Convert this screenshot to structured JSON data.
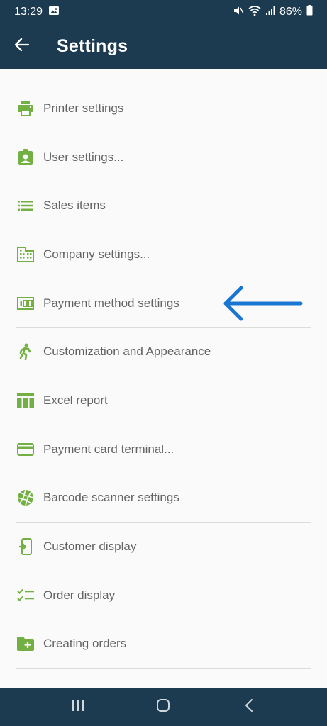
{
  "status_bar": {
    "time": "13:29",
    "battery": "86%"
  },
  "app_bar": {
    "title": "Settings"
  },
  "settings_items": [
    {
      "label": "Printer settings",
      "icon": "printer-icon"
    },
    {
      "label": "User settings...",
      "icon": "user-badge-icon"
    },
    {
      "label": "Sales items",
      "icon": "list-icon"
    },
    {
      "label": "Company settings...",
      "icon": "building-icon"
    },
    {
      "label": "Payment method settings",
      "icon": "money-icon"
    },
    {
      "label": "Customization and Appearance",
      "icon": "running-person-icon"
    },
    {
      "label": "Excel report",
      "icon": "table-icon"
    },
    {
      "label": "Payment card terminal...",
      "icon": "credit-card-icon"
    },
    {
      "label": "Barcode scanner settings",
      "icon": "aperture-icon"
    },
    {
      "label": "Customer display",
      "icon": "phone-display-icon"
    },
    {
      "label": "Order display",
      "icon": "checklist-icon"
    },
    {
      "label": "Creating orders",
      "icon": "folder-add-icon"
    }
  ],
  "colors": {
    "bar": "#1c3a50",
    "icon_green": "#72b043",
    "annotation_arrow": "#1976d2"
  }
}
